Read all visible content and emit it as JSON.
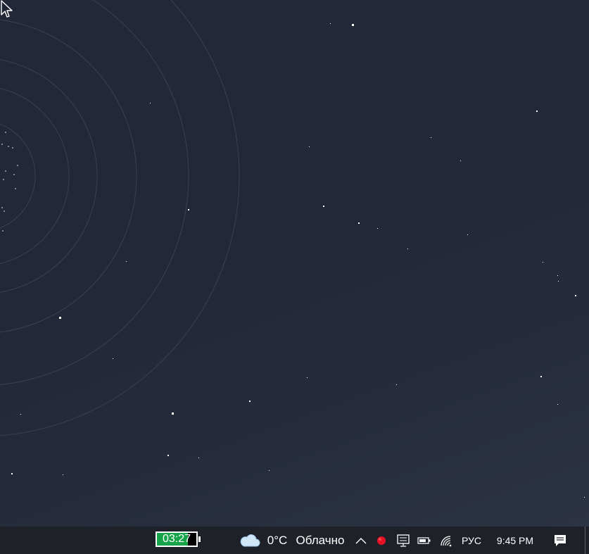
{
  "taskbar": {
    "battery_widget": {
      "time": "03:27",
      "fill_fraction": 0.78
    },
    "weather": {
      "icon": "cloud-icon",
      "temperature": "0°C",
      "condition": "Облачно"
    },
    "tray": {
      "overflow_icon": "chevron-up-icon",
      "record_icon": "record-icon",
      "display_icon": "display-icon",
      "battery_icon": "battery-icon",
      "wifi_icon": "wifi-icon"
    },
    "language": "РУС",
    "clock": "9:45 PM",
    "notifications_icon": "action-center-icon"
  },
  "colors": {
    "taskbar_bg": "#1e2128",
    "battery_fill": "#17a34a",
    "record_dot": "#e81123"
  }
}
